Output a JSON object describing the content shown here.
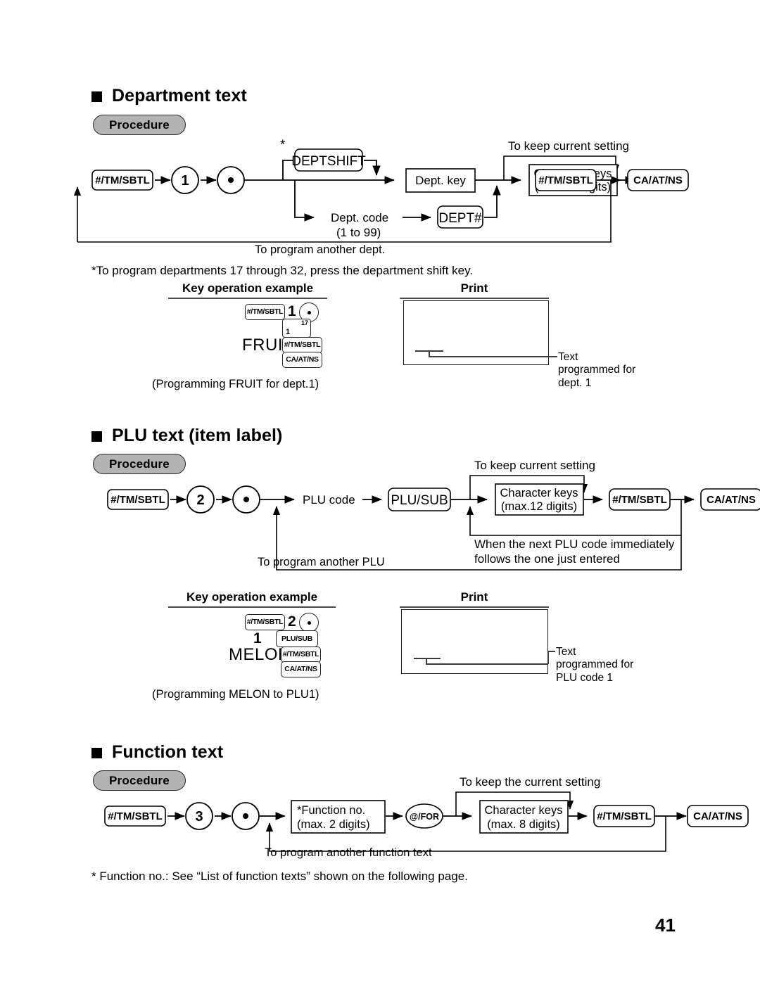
{
  "page": {
    "number": "41"
  },
  "sections": [
    {
      "id": "department-text",
      "title": "Department text",
      "procedure_label": "Procedure",
      "flow": {
        "start_key": "#/TM/SBTL",
        "mode_number": "1",
        "dot": "•",
        "asterisk": "*",
        "dept_shift_key": "DEPTSHIFT",
        "dept_key": "Dept. key",
        "dept_code_line1": "Dept. code",
        "dept_code_line2": "(1 to 99)",
        "dept_hash_key": "DEPT#",
        "keep_setting": "To keep current setting",
        "char_keys_line1": "Character keys",
        "char_keys_line2": "(max.12 digits)",
        "confirm_key": "#/TM/SBTL",
        "finish_key": "CA/AT/NS",
        "loop_label": "To program another dept."
      },
      "footnote": "*To program departments 17 through 32, press the department shift key.",
      "example_header": "Key operation example",
      "print_header": "Print",
      "example_keys": {
        "k1": "#/TM/SBTL",
        "k2": "1",
        "k3": "•",
        "dual_low": "1",
        "dual_high": "17",
        "entry_text": "FRUIT",
        "k4": "#/TM/SBTL",
        "k5": "CA/AT/NS"
      },
      "example_caption": "(Programming FRUIT for dept.1)",
      "print_callout": "Text\nprogrammed for\ndept. 1"
    },
    {
      "id": "plu-text",
      "title": "PLU text (item label)",
      "procedure_label": "Procedure",
      "flow": {
        "start_key": "#/TM/SBTL",
        "mode_number": "2",
        "dot": "•",
        "plu_code": "PLU code",
        "plu_sub_key": "PLU/SUB",
        "keep_setting": "To keep current setting",
        "char_keys_line1": "Character keys",
        "char_keys_line2": "(max.12 digits)",
        "confirm_key": "#/TM/SBTL",
        "finish_key": "CA/AT/NS",
        "inner_loop_line1": "When the next PLU code immediately",
        "inner_loop_line2": "follows the one just entered",
        "loop_label": "To program another PLU"
      },
      "example_header": "Key operation example",
      "print_header": "Print",
      "example_keys": {
        "k1": "#/TM/SBTL",
        "k2": "2",
        "k3": "•",
        "code": "1",
        "plu_sub": "PLU/SUB",
        "entry_text": "MELON",
        "k4": "#/TM/SBTL",
        "k5": "CA/AT/NS"
      },
      "example_caption": "(Programming MELON to PLU1)",
      "print_callout": "Text\nprogrammed for\nPLU code 1"
    },
    {
      "id": "function-text",
      "title": "Function text",
      "procedure_label": "Procedure",
      "flow": {
        "start_key": "#/TM/SBTL",
        "mode_number": "3",
        "dot": "•",
        "function_no_line1": "*Function no.",
        "function_no_line2": "(max. 2 digits)",
        "at_for_key": "@/FOR",
        "keep_setting": "To keep the current setting",
        "char_keys_line1": "Character keys",
        "char_keys_line2": "(max. 8 digits)",
        "confirm_key": "#/TM/SBTL",
        "finish_key": "CA/AT/NS",
        "loop_label": "To program another function text"
      },
      "footnote": "* Function no.: See “List of function texts” shown on the following page."
    }
  ],
  "colors": {
    "ink": "#000000",
    "pill_fill": "#b3b3b3",
    "rule": "#4a4a4a"
  }
}
